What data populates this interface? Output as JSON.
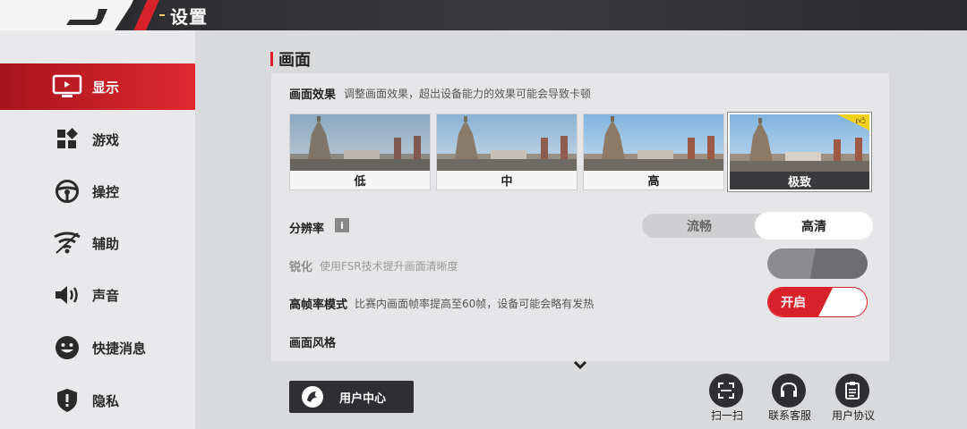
{
  "header": {
    "title": "设置"
  },
  "sidebar": {
    "items": [
      {
        "label": "显示",
        "icon": "monitor-icon",
        "active": true
      },
      {
        "label": "游戏",
        "icon": "apps-grid-icon",
        "active": false
      },
      {
        "label": "操控",
        "icon": "steering-wheel-icon",
        "active": false
      },
      {
        "label": "辅助",
        "icon": "wifi-assist-icon",
        "active": false
      },
      {
        "label": "声音",
        "icon": "speaker-icon",
        "active": false
      },
      {
        "label": "快捷消息",
        "icon": "smiley-icon",
        "active": false
      },
      {
        "label": "隐私",
        "icon": "shield-icon",
        "active": false
      }
    ]
  },
  "section": {
    "title": "画面"
  },
  "graphics": {
    "label": "画面效果",
    "desc": "调整画面效果，超出设备能力的效果可能会导致卡顿",
    "options": [
      "低",
      "中",
      "高",
      "极致"
    ],
    "selected": "极致",
    "selected_badge_icon": "thumbs-up-icon"
  },
  "resolution": {
    "label": "分辨率",
    "info_icon": "i",
    "options": [
      "流畅",
      "高清"
    ],
    "selected": "高清"
  },
  "sharpen": {
    "label": "锐化",
    "desc": "使用FSR技术提升画面清晰度",
    "enabled": false,
    "state": "off"
  },
  "hfr": {
    "label": "高帧率模式",
    "desc": "比赛内画面帧率提高至60帧，设备可能会略有发热",
    "toggle_text": "开启",
    "state": "on"
  },
  "style": {
    "label": "画面风格"
  },
  "footer": {
    "user_center": "用户中心",
    "scan": "扫一扫",
    "support": "联系客服",
    "agreement": "用户协议"
  },
  "colors": {
    "accent": "#d8222b",
    "dark": "#2f2f33",
    "badge": "#f2d11b"
  }
}
